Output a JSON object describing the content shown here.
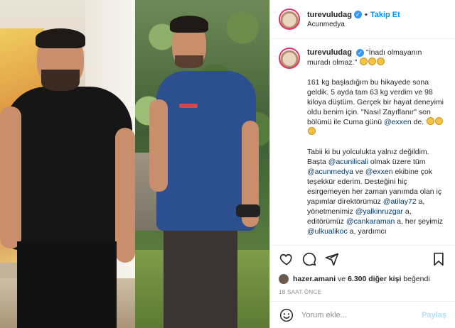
{
  "header": {
    "username": "turevuludag",
    "follow_label": "Takip Et",
    "location": "Acunmedya"
  },
  "caption": {
    "username": "turevuludag",
    "quote": "\"İnadı olmayanın muradı olmaz.\"",
    "p1_a": "161 kg başladığım bu hikayede sona geldik. 5 ayda tam 63 kg verdim ve 98 kiloya düştüm. Gerçek bir hayat deneyimi oldu benim için. \"Nasıl Zayıflanır\" son bölümü ile Cuma günü ",
    "p1_mention": "@exxen",
    "p1_b": " de.",
    "p2_a": "Tabii ki bu yolculukta yalnız değildim. Başta ",
    "m_acunilicali": "@acunilicali",
    "p2_b": " olmak üzere tüm ",
    "m_acunmedya": "@acunmedya",
    "p2_c": " ve ",
    "m_exxen": "@exxen",
    "p2_d": " ekibine çok teşekkür ederim. Desteğini hiç esirgemeyen her zaman yanımda olan iç yapımlar direktörümüz ",
    "m_atilay72": "@atilay72",
    "p2_e": " a, yönetmenimiz ",
    "m_yalkinruzgar": "@yalkinruzgar",
    "p2_f": " a, editörümüz ",
    "m_cankaraman": "@cankaraman",
    "p2_g": " a, her şeyimiz ",
    "m_ulkualikoc": "@ulkualikoc",
    "p2_h": " a, yardımcı"
  },
  "likes": {
    "liker": "hazer.amani",
    "and": "ve",
    "count_text": "6.300 diğer kişi",
    "suffix": "beğendi"
  },
  "time_ago": "18 SAAT ÖNCE",
  "comment": {
    "placeholder": "Yorum ekle...",
    "post_label": "Paylaş"
  },
  "icons": {
    "like": "heart-icon",
    "comment": "comment-icon",
    "share": "paper-plane-icon",
    "save": "bookmark-icon",
    "emoji": "smiley-icon",
    "verified": "verified-badge-icon"
  },
  "colors": {
    "accent_blue": "#0095f6",
    "verified_blue": "#3897f0",
    "mention": "#00376b",
    "muted": "#8e8e8e"
  }
}
